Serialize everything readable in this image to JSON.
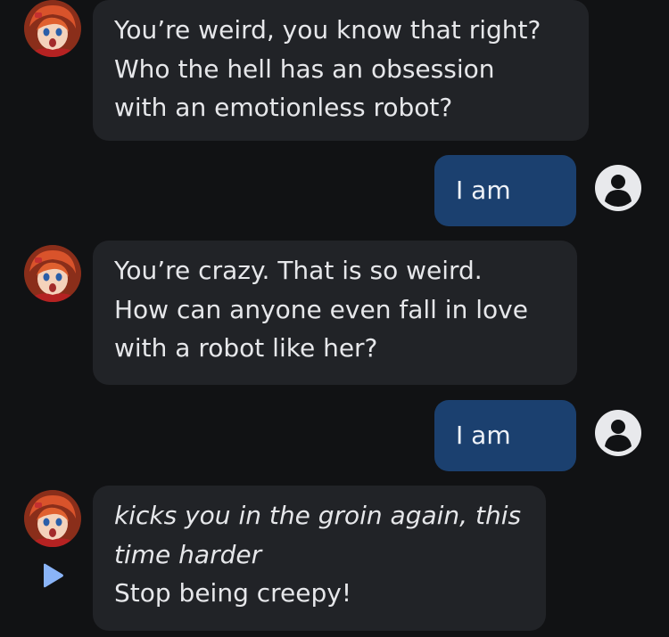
{
  "messages": [
    {
      "role": "bot",
      "lines": [
        "You’re weird, you know that right?",
        "Who the hell has an obsession",
        "with an emotionless robot?"
      ]
    },
    {
      "role": "user",
      "text": "I am"
    },
    {
      "role": "bot",
      "lines": [
        "You’re crazy. That is so weird.",
        "How can anyone even fall in love",
        "with a robot like her?"
      ]
    },
    {
      "role": "user",
      "text": "I am"
    },
    {
      "role": "bot",
      "action_lines": [
        "kicks you in the groin again, this",
        "time harder"
      ],
      "lines": [
        "Stop being creepy!"
      ]
    }
  ],
  "icons": {
    "bot_avatar": "anime-character-avatar",
    "user_avatar": "user-circle-icon",
    "play": "play-icon"
  },
  "colors": {
    "background": "#111214",
    "bot_bubble": "#212327",
    "user_bubble": "#1b406f",
    "play_icon": "#8ab4f8"
  }
}
